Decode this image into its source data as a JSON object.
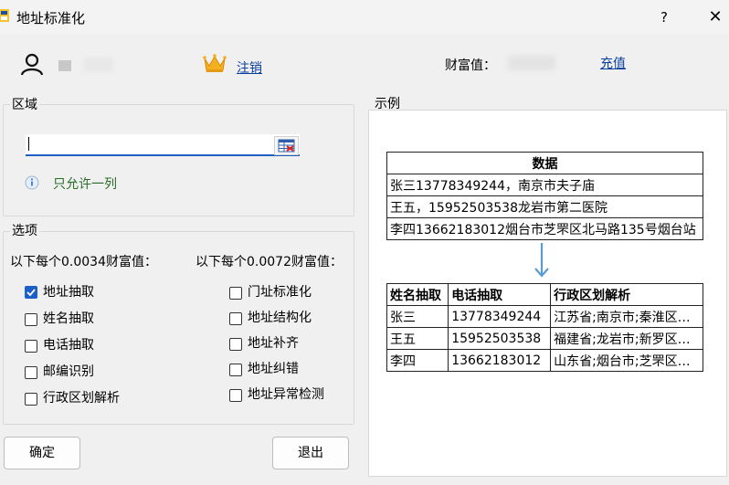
{
  "window": {
    "title": "地址标准化",
    "help_label": "?",
    "close_label": "✕"
  },
  "user": {
    "logout_label": "注销",
    "wealth_label": "财富值：",
    "recharge_label": "充值"
  },
  "region": {
    "legend": "区域",
    "input_value": "",
    "hint": "只允许一列"
  },
  "options": {
    "legend": "选项",
    "price_left": "以下每个0.0034财富值：",
    "price_right": "以下每个0.0072财富值：",
    "left": [
      {
        "label": "地址抽取",
        "checked": true
      },
      {
        "label": "姓名抽取",
        "checked": false
      },
      {
        "label": "电话抽取",
        "checked": false
      },
      {
        "label": "邮编识别",
        "checked": false
      },
      {
        "label": "行政区划解析",
        "checked": false
      }
    ],
    "right": [
      {
        "label": "门址标准化",
        "checked": false
      },
      {
        "label": "地址结构化",
        "checked": false
      },
      {
        "label": "地址补齐",
        "checked": false
      },
      {
        "label": "地址纠错",
        "checked": false
      },
      {
        "label": "地址异常检测",
        "checked": false
      }
    ]
  },
  "buttons": {
    "ok": "确定",
    "exit": "退出"
  },
  "example": {
    "legend": "示例",
    "input_header": "数据",
    "input_rows": [
      "张三13778349244，南京市夫子庙",
      "王五，15952503538龙岩市第二医院",
      "李四13662183012烟台市芝罘区北马路135号烟台站"
    ],
    "output_headers": [
      "姓名抽取",
      "电话抽取",
      "行政区划解析"
    ],
    "output_rows": [
      [
        "张三",
        "13778349244",
        "江苏省;南京市;秦淮区…"
      ],
      [
        "王五",
        "15952503538",
        "福建省;龙岩市;新罗区…"
      ],
      [
        "李四",
        "13662183012",
        "山东省;烟台市;芝罘区…"
      ]
    ]
  },
  "colors": {
    "link": "#0b3f9e",
    "hint_green": "#2a6d2a",
    "checkbox_blue": "#1d5fc8",
    "arrow_blue": "#5b9bd5"
  },
  "icons": [
    "app-icon",
    "help-icon",
    "close-icon",
    "user-icon",
    "crown-icon",
    "table-picker-icon",
    "info-icon",
    "down-arrow-icon"
  ]
}
